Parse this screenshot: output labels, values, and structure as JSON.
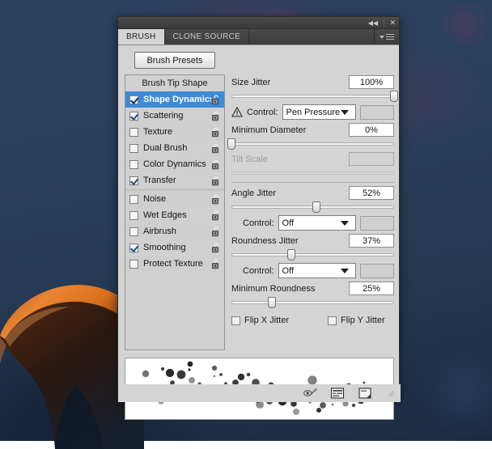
{
  "background": {
    "name": "dark-blue-artwork-with-creature-silhouette",
    "sky_color": "#2c4160",
    "deep_color": "#1b2b42",
    "creature_rim_light": "#e8772a",
    "creature_body": "#2a1a14"
  },
  "panel": {
    "titlebar": {
      "collapse_label": "◀◀",
      "collapse_name": "collapse-to-icons-button",
      "separator": "|",
      "close_label": "✕",
      "close_name": "close-panel-button"
    },
    "tabs": [
      {
        "label": "BRUSH",
        "active": true
      },
      {
        "label": "CLONE SOURCE",
        "active": false
      }
    ],
    "menu_icon": "panel-menu-icon"
  },
  "presets": {
    "button_label": "Brush Presets"
  },
  "brush_list": {
    "header": "Brush Tip Shape",
    "items": [
      {
        "label": "Shape Dynamics",
        "checked": true,
        "selected": true,
        "locked": false
      },
      {
        "label": "Scattering",
        "checked": true,
        "selected": false,
        "locked": false
      },
      {
        "label": "Texture",
        "checked": false,
        "selected": false,
        "locked": false
      },
      {
        "label": "Dual Brush",
        "checked": false,
        "selected": false,
        "locked": false
      },
      {
        "label": "Color Dynamics",
        "checked": false,
        "selected": false,
        "locked": false
      },
      {
        "label": "Transfer",
        "checked": true,
        "selected": false,
        "locked": false
      },
      {
        "label": "Noise",
        "checked": false,
        "selected": false,
        "locked": false
      },
      {
        "label": "Wet Edges",
        "checked": false,
        "selected": false,
        "locked": false
      },
      {
        "label": "Airbrush",
        "checked": false,
        "selected": false,
        "locked": false
      },
      {
        "label": "Smoothing",
        "checked": true,
        "selected": false,
        "locked": false
      },
      {
        "label": "Protect Texture",
        "checked": false,
        "selected": false,
        "locked": false
      }
    ]
  },
  "controls": {
    "size_jitter": {
      "label": "Size Jitter",
      "value": "100%",
      "slider_percent": 100
    },
    "size_control": {
      "label": "Control:",
      "value": "Pen Pressure",
      "warning_icon": "warning-triangle-icon"
    },
    "minimum_diameter": {
      "label": "Minimum Diameter",
      "value": "0%",
      "slider_percent": 0
    },
    "tilt_scale": {
      "label": "Tilt Scale",
      "value": "",
      "slider_percent": 0,
      "disabled": true
    },
    "angle_jitter": {
      "label": "Angle Jitter",
      "value": "52%",
      "slider_percent": 52
    },
    "angle_control": {
      "label": "Control:",
      "value": "Off"
    },
    "roundness_jitter": {
      "label": "Roundness Jitter",
      "value": "37%",
      "slider_percent": 37
    },
    "roundness_control": {
      "label": "Control:",
      "value": "Off"
    },
    "minimum_roundness": {
      "label": "Minimum Roundness",
      "value": "25%",
      "slider_percent": 25
    },
    "flip_x": {
      "label": "Flip X Jitter",
      "checked": false
    },
    "flip_y": {
      "label": "Flip Y Jitter",
      "checked": false
    }
  },
  "preview": {
    "name": "brush-stroke-preview",
    "description": "scattered dark dots brush stroke"
  },
  "footer": {
    "icons": [
      {
        "name": "toggle-live-tip-brush-preview-icon"
      },
      {
        "name": "open-preset-manager-icon"
      },
      {
        "name": "create-new-brush-icon"
      }
    ],
    "resize_grip": "resize-grip"
  },
  "colors": {
    "panel_bg": "#d4d4d4",
    "selection_blue": "#3d8ad6",
    "titlebar": "#3f3f3f",
    "border": "#2e2e2e"
  }
}
